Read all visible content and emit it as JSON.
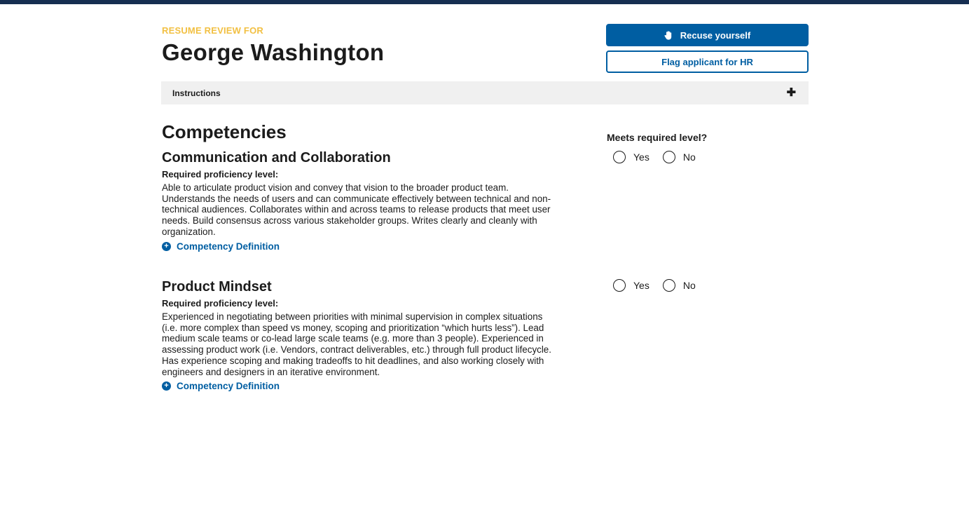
{
  "header": {
    "eyebrow": "RESUME REVIEW FOR",
    "applicant_name": "George Washington"
  },
  "actions": {
    "recuse_label": "Recuse yourself",
    "recuse_icon": "hand-icon",
    "flag_label": "Flag applicant for HR"
  },
  "instructions": {
    "label": "Instructions",
    "toggle_icon": "plus-icon"
  },
  "competencies": {
    "title": "Competencies",
    "meets_label": "Meets required level?",
    "items": [
      {
        "name": "Communication and Collaboration",
        "req_label": "Required proficiency level:",
        "description": "Able to articulate product vision and convey that vision to the broader product team. Understands the needs of users and can communicate effectively between technical and non-technical audiences.  Collaborates within and across teams to release products that meet user needs.  Build consensus across various stakeholder groups. Writes clearly and cleanly with organization.",
        "definition_link": "Competency Definition",
        "options": [
          "Yes",
          "No"
        ]
      },
      {
        "name": "Product Mindset",
        "req_label": "Required proficiency level:",
        "description": "Experienced in negotiating between priorities with minimal supervision in complex situations (i.e. more complex than speed vs money, scoping and prioritization “which hurts less”). Lead medium scale teams or co-lead large scale teams (e.g. more than 3 people). Experienced in assessing product work (i.e. Vendors, contract deliverables, etc.) through full product lifecycle. Has experience scoping and making tradeoffs to hit deadlines, and also working closely with engineers and designers in an iterative environment.",
        "definition_link": "Competency Definition",
        "options": [
          "Yes",
          "No"
        ]
      }
    ]
  },
  "colors": {
    "top_bar": "#162e51",
    "eyebrow": "#f2c043",
    "primary": "#005ea2",
    "accordion_bg": "#f0f0f0"
  }
}
